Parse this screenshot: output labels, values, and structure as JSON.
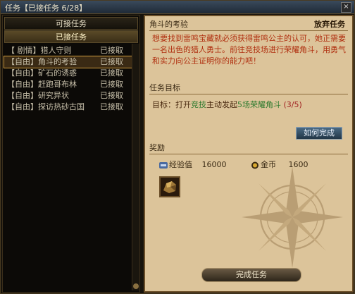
{
  "window": {
    "title": "任务【已接任务 6/28】",
    "close": "×"
  },
  "tabs": {
    "available": "可接任务",
    "accepted": "已接任务"
  },
  "quests": [
    {
      "name": "【 剧情】猎人守则",
      "status": "已接取"
    },
    {
      "name": "【自由】角斗的考验",
      "status": "已接取"
    },
    {
      "name": "【自由】矿石的诱惑",
      "status": "已接取"
    },
    {
      "name": "【自由】赶跑哥布林",
      "status": "已接取"
    },
    {
      "name": "【自由】研究异状",
      "status": "已接取"
    },
    {
      "name": "【自由】探访热砂古国",
      "status": "已接取"
    }
  ],
  "detail": {
    "title": "角斗的考验",
    "abandon": "放弃任务",
    "description": "想要找到雷鸣宝藏就必须获得雷鸣公主的认可，她正需要一名出色的猎人勇士。前往竞技场进行荣耀角斗，用勇气和实力向公主证明你的能力吧！",
    "objective_header": "任务目标",
    "objective_prefix": "目标：打开",
    "objective_link": "竞技",
    "objective_mid": "主动发起",
    "objective_goal": "5场荣耀角斗",
    "objective_progress": "(3/5)",
    "how_to": "如何完成",
    "reward_header": "奖励",
    "exp_label": "经验值",
    "exp_value": "16000",
    "gold_label": "金币",
    "gold_value": "1600",
    "complete": "完成任务"
  },
  "icons": {
    "exp": "exp-badge",
    "gold": "gold-coin",
    "item": "ore-item"
  },
  "colors": {
    "description_text": "#b03010",
    "objective_link": "#2e7a2e",
    "progress": "#a02020",
    "panel_bg": "#dcc49a"
  }
}
